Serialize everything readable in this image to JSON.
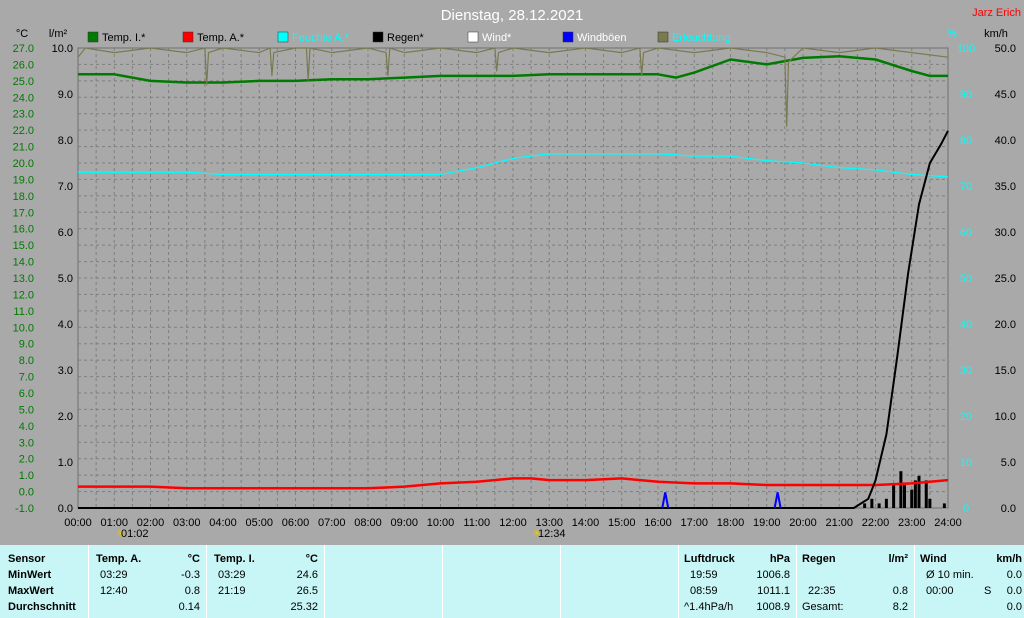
{
  "title": "Dienstag, 28.12.2021",
  "brand": "Jarz Erich",
  "colors": {
    "background": "#a9a9a9",
    "plot_bg": "#a9a9a9",
    "grid": "#7f7f7f",
    "temp_in": "#007a00",
    "temp_out": "#ff0000",
    "humidity": "#00ffff",
    "rain": "#000000",
    "wind": "#ffffff",
    "gust": "#0000ff",
    "lighting": "#7a7a50",
    "left_axis": "#007a00",
    "rain_axis": "#000000",
    "hum_axis": "#00ffff",
    "wind_axis": "#000000",
    "brand": "#ff0000",
    "title": "#ffffff",
    "table_bg": "#c8f5f5"
  },
  "units": {
    "left": "°C",
    "rain": "l/m²",
    "humidity": "%",
    "wind": "km/h"
  },
  "legend": [
    {
      "label": "Temp. I.*",
      "color": "#007a00",
      "text_color": "#000000"
    },
    {
      "label": "Temp. A.*",
      "color": "#ff0000",
      "text_color": "#000000"
    },
    {
      "label": "Feuchte A.*",
      "color": "#00ffff",
      "text_color": "#00ffff"
    },
    {
      "label": "Regen*",
      "color": "#000000",
      "text_color": "#000000"
    },
    {
      "label": "Wind*",
      "color": "#ffffff",
      "text_color": "#ffffff"
    },
    {
      "label": "Windböen",
      "color": "#0000ff",
      "text_color": "#ffffff"
    },
    {
      "label": "Erleuchtung",
      "color": "#7a7a50",
      "text_color": "#00ffff"
    }
  ],
  "axis_labels": {
    "temp": [
      "27.0",
      "26.0",
      "25.0",
      "24.0",
      "23.0",
      "22.0",
      "21.0",
      "20.0",
      "19.0",
      "18.0",
      "17.0",
      "16.0",
      "15.0",
      "14.0",
      "13.0",
      "12.0",
      "11.0",
      "10.0",
      "9.0",
      "8.0",
      "7.0",
      "6.0",
      "5.0",
      "4.0",
      "3.0",
      "2.0",
      "1.0",
      "0.0",
      "-1.0"
    ],
    "rain": [
      "10.0",
      "9.0",
      "8.0",
      "7.0",
      "6.0",
      "5.0",
      "4.0",
      "3.0",
      "2.0",
      "1.0",
      "0.0"
    ],
    "humidity": [
      "100",
      "90",
      "80",
      "70",
      "60",
      "50",
      "40",
      "30",
      "20",
      "10",
      "0"
    ],
    "wind": [
      "50.0",
      "45.0",
      "40.0",
      "35.0",
      "30.0",
      "25.0",
      "20.0",
      "15.0",
      "10.0",
      "5.0",
      "0.0"
    ],
    "time": [
      "00:00",
      "01:00",
      "02:00",
      "03:00",
      "04:00",
      "05:00",
      "06:00",
      "07:00",
      "08:00",
      "09:00",
      "10:00",
      "11:00",
      "12:00",
      "13:00",
      "14:00",
      "15:00",
      "16:00",
      "17:00",
      "18:00",
      "19:00",
      "20:00",
      "21:00",
      "22:00",
      "23:00",
      "24:00"
    ]
  },
  "sun": {
    "sunrise_label": "01:02",
    "sunset_label": "12:34"
  },
  "chart_data": {
    "type": "line",
    "title": "Dienstag, 28.12.2021",
    "x_unit": "hour",
    "xlim": [
      0,
      24
    ],
    "ylim_temp": [
      -1,
      27
    ],
    "ylim_rain": [
      0,
      10
    ],
    "ylim_humidity": [
      0,
      100
    ],
    "ylim_wind": [
      0,
      50
    ],
    "grid": true,
    "legend_position": "top",
    "series": [
      {
        "name": "Temp. I.*",
        "axis": "temp",
        "x": [
          0,
          1,
          2,
          3,
          4,
          5,
          6,
          7,
          8,
          9,
          10,
          11,
          12,
          13,
          14,
          15,
          16,
          16.5,
          17,
          18,
          19,
          20,
          21,
          22,
          23,
          23.5,
          24
        ],
        "y": [
          25.4,
          25.4,
          25.0,
          24.9,
          24.9,
          25.0,
          25.0,
          25.1,
          25.1,
          25.2,
          25.3,
          25.3,
          25.3,
          25.4,
          25.4,
          25.4,
          25.4,
          25.2,
          25.5,
          26.3,
          26.0,
          26.4,
          26.5,
          26.3,
          25.6,
          25.3,
          25.3
        ]
      },
      {
        "name": "Temp. A.*",
        "axis": "temp",
        "x": [
          0,
          1,
          2,
          3,
          4,
          5,
          6,
          7,
          8,
          9,
          10,
          11,
          12,
          12.5,
          13,
          14,
          15,
          16,
          17,
          18,
          19,
          20,
          21,
          22,
          23,
          24
        ],
        "y": [
          0.3,
          0.3,
          0.3,
          0.2,
          0.2,
          0.2,
          0.2,
          0.2,
          0.2,
          0.3,
          0.5,
          0.6,
          0.8,
          0.8,
          0.7,
          0.7,
          0.8,
          0.6,
          0.5,
          0.5,
          0.4,
          0.4,
          0.4,
          0.4,
          0.5,
          0.7
        ]
      },
      {
        "name": "Feuchte A.*",
        "axis": "humidity",
        "x": [
          0,
          1,
          2,
          3,
          4,
          5,
          6,
          7,
          8,
          9,
          10,
          11,
          12,
          13,
          14,
          15,
          16,
          17,
          18,
          19,
          20,
          21,
          22,
          23,
          24
        ],
        "y": [
          73,
          73,
          73,
          73,
          72.5,
          72.5,
          72.5,
          72.5,
          72.5,
          72.5,
          72.5,
          74,
          76,
          77,
          77,
          77,
          77,
          76.5,
          76.5,
          75.5,
          75,
          74,
          73.5,
          72.5,
          72
        ]
      },
      {
        "name": "Regen*",
        "axis": "rain",
        "x": [
          0,
          21.4,
          21.8,
          22.0,
          22.3,
          22.6,
          22.9,
          23.2,
          23.5,
          23.8,
          24
        ],
        "y": [
          0,
          0,
          0.2,
          0.6,
          1.6,
          3.3,
          5.1,
          6.6,
          7.5,
          7.9,
          8.2
        ]
      },
      {
        "name": "Windböen",
        "axis": "wind",
        "x": [
          16.2,
          19.3
        ],
        "y": [
          1.7,
          1.7
        ]
      },
      {
        "name": "Erleuchtung",
        "axis": "humidity",
        "x": [
          0,
          0.2,
          1,
          2,
          3,
          3.5,
          3.55,
          3.6,
          4,
          5,
          5.3,
          5.35,
          5.4,
          6,
          6.3,
          6.35,
          6.4,
          7,
          8,
          8.5,
          8.55,
          8.6,
          9,
          10,
          11,
          11.5,
          11.55,
          11.6,
          12,
          13,
          14,
          15,
          15.5,
          15.55,
          15.6,
          16,
          17,
          18,
          19,
          19.5,
          19.55,
          19.6,
          20,
          21,
          22,
          23,
          24
        ],
        "y": [
          98,
          100,
          99,
          100,
          99,
          100,
          92,
          99,
          100,
          99,
          100,
          94,
          99,
          100,
          100,
          93,
          100,
          99,
          100,
          99,
          94,
          100,
          99,
          100,
          99,
          100,
          95,
          99,
          100,
          99,
          100,
          99,
          100,
          94,
          99,
          100,
          99,
          100,
          99,
          98,
          83,
          97,
          100,
          99,
          100,
          99,
          98
        ]
      }
    ],
    "rain_bars": {
      "x": [
        21.7,
        21.9,
        22.1,
        22.3,
        22.5,
        22.7,
        22.8,
        23.0,
        23.1,
        23.2,
        23.4,
        23.5,
        23.9
      ],
      "y": [
        0.1,
        0.2,
        0.1,
        0.2,
        0.5,
        0.8,
        0.5,
        0.4,
        0.6,
        0.7,
        0.6,
        0.2,
        0.1
      ]
    }
  },
  "table": {
    "sensor": {
      "header": "Sensor",
      "min": "MinWert",
      "max": "MaxWert",
      "avg": "Durchschnitt"
    },
    "temp_a": {
      "header": "Temp. A.",
      "unit": "°C",
      "min_time": "03:29",
      "min_val": "-0.3",
      "max_time": "12:40",
      "max_val": "0.8",
      "avg": "0.14"
    },
    "temp_i": {
      "header": "Temp. I.",
      "unit": "°C",
      "min_time": "03:29",
      "min_val": "24.6",
      "max_time": "21:19",
      "max_val": "26.5",
      "avg": "25.32"
    },
    "pressure": {
      "header": "Luftdruck",
      "unit": "hPa",
      "min_time": "19:59",
      "min_val": "1006.8",
      "max_time": "08:59",
      "max_val": "1011.1",
      "avg_label": "^1.4hPa/h",
      "avg": "1008.9"
    },
    "rain": {
      "header": "Regen",
      "unit": "l/m²",
      "max_time": "22:35",
      "max_val": "0.8",
      "total_label": "Gesamt:",
      "total": "8.2"
    },
    "wind": {
      "header": "Wind",
      "unit": "km/h",
      "min_label": "Ø 10 min.",
      "min_val": "0.0",
      "max_time": "00:00",
      "max_dir": "S",
      "max_val": "0.0",
      "avg": "0.0"
    }
  }
}
